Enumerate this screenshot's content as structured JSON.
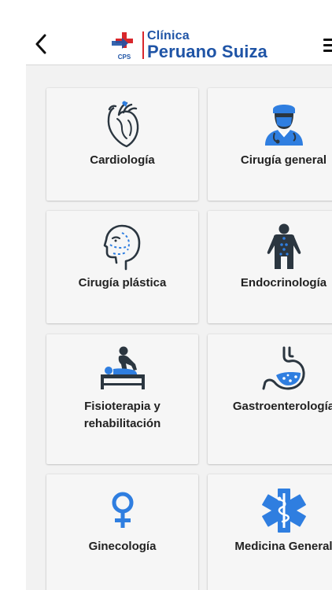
{
  "header": {
    "logo": {
      "badge": "CPS",
      "line1": "Clínica",
      "line2": "Peruano Suiza"
    }
  },
  "specialties": [
    {
      "label": "Cardiología",
      "icon": "heart-icon"
    },
    {
      "label": "Cirugía general",
      "icon": "surgeon-icon"
    },
    {
      "label": "Cirugía plástica",
      "icon": "face-profile-icon"
    },
    {
      "label": "Endocrinología",
      "icon": "body-glands-icon"
    },
    {
      "label": "Fisioterapia y",
      "label2": "rehabilitación",
      "icon": "massage-table-icon"
    },
    {
      "label": "Gastroenterología",
      "icon": "stomach-icon"
    },
    {
      "label": "Ginecología",
      "icon": "female-symbol-icon"
    },
    {
      "label": "Medicina General",
      "icon": "star-of-life-icon"
    }
  ],
  "colors": {
    "accent_blue": "#2f7ee0",
    "icon_dark": "#2b3640",
    "logo_blue": "#1f54a6",
    "logo_red": "#d8272c"
  }
}
